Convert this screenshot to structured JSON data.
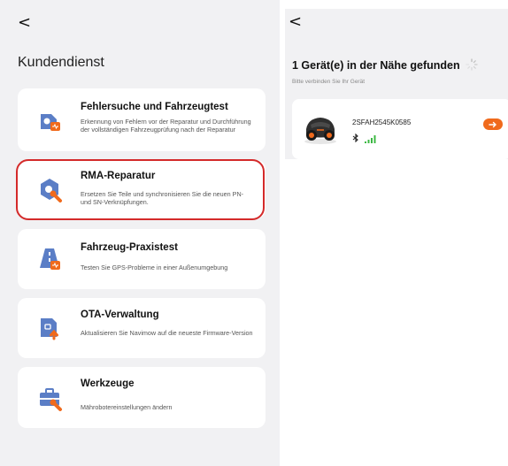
{
  "left": {
    "back_label": "<",
    "title": "Kundendienst",
    "cards": [
      {
        "title": "Fehlersuche und Fahrzeugtest",
        "desc": "Erkennung von Fehlern vor der Reparatur und Durchführung der vollständigen Fahrzeugprüfung nach der Reparatur"
      },
      {
        "title": "RMA-Reparatur",
        "desc": "Ersetzen Sie Teile und synchronisieren Sie die neuen PN- und SN-Verknüpfungen."
      },
      {
        "title": "Fahrzeug-Praxistest",
        "desc": "Testen Sie GPS-Probleme in einer Außenumgebung"
      },
      {
        "title": "OTA-Verwaltung",
        "desc": "Aktualisieren Sie Navimow auf die neueste Firmware-Version"
      },
      {
        "title": "Werkzeuge",
        "desc": "Mährobotereinstellungen ändern"
      }
    ],
    "highlighted_card": "RMA-Reparatur"
  },
  "right": {
    "back_label": "<",
    "title": "1 Gerät(e) in der Nähe gefunden",
    "subtitle": "Bitte verbinden Sie Ihr Gerät",
    "device": {
      "name": "2SFAH2545K0585",
      "bluetooth_icon": "bluetooth-icon",
      "signal_icon": "signal-strength-icon",
      "connect_icon": "arrow-right-icon"
    }
  },
  "colors": {
    "accent": "#f06a1c",
    "icon_blue": "#5b7ec6",
    "highlight": "#d42a2a",
    "signal": "#3cb843"
  }
}
